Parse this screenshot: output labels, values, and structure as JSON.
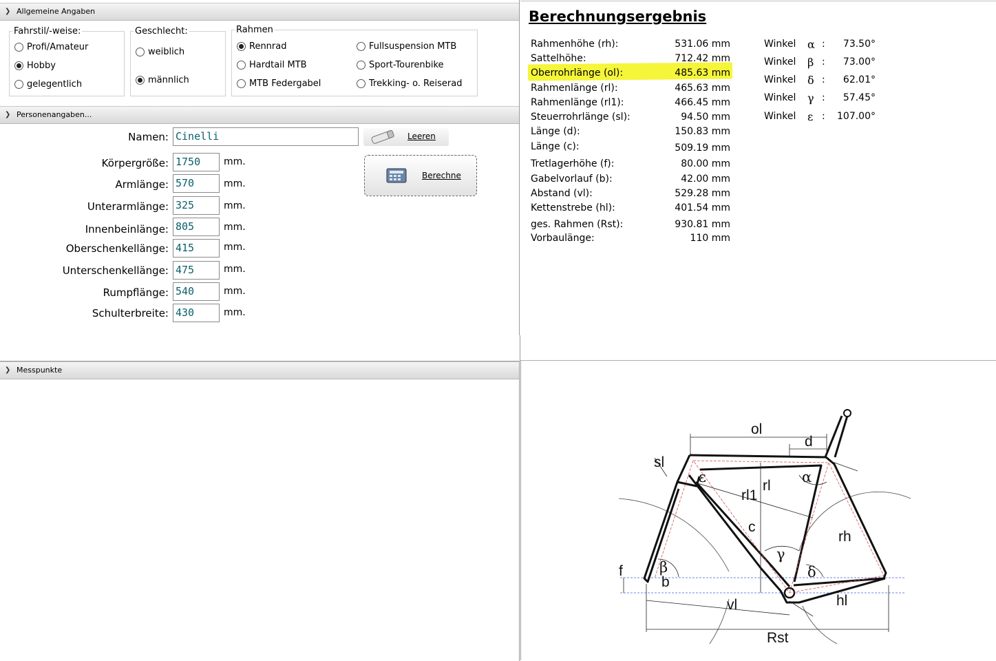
{
  "sections": {
    "general": "Allgemeine Angaben",
    "person": "Personenangaben...",
    "measure": "Messpunkte"
  },
  "ridingStyle": {
    "legend": "Fahrstil/-weise:",
    "options": [
      "Profi/Amateur",
      "Hobby",
      "gelegentlich"
    ],
    "selected": "Hobby"
  },
  "gender": {
    "legend": "Geschlecht:",
    "options": [
      "weiblich",
      "männlich"
    ],
    "selected": "männlich"
  },
  "frame": {
    "legend": "Rahmen",
    "options": [
      "Rennrad",
      "Fullsuspension MTB",
      "Hardtail MTB",
      "Sport-Tourenbike",
      "MTB Federgabel",
      "Trekking- o. Reiserad"
    ],
    "selected": "Rennrad"
  },
  "person": {
    "name_label": "Namen:",
    "name_value": "Cinelli",
    "unit": "mm.",
    "fields": [
      {
        "label": "Körpergröße:",
        "value": "1750"
      },
      {
        "label": "Armlänge:",
        "value": "570"
      },
      {
        "label": "Unterarmlänge:",
        "value": "325"
      },
      {
        "label": "Innenbeinlänge:",
        "value": "805"
      },
      {
        "label": "Oberschenkellänge:",
        "value": "415"
      },
      {
        "label": "Unterschenkellänge:",
        "value": "475"
      },
      {
        "label": "Rumpflänge:",
        "value": "540"
      },
      {
        "label": "Schulterbreite:",
        "value": "430"
      }
    ]
  },
  "buttons": {
    "clear": "Leeren",
    "calc": "Berechne"
  },
  "results": {
    "title": "Berechnungsergebnis",
    "rows": [
      {
        "label": "Rahmenhöhe (rh):",
        "value": "531.06 mm"
      },
      {
        "label": "Sattelhöhe:",
        "value": "712.42 mm"
      },
      {
        "label": "Oberrohrlänge (ol):",
        "value": "485.63 mm"
      },
      {
        "label": "Rahmenlänge (rl):",
        "value": "465.63 mm"
      },
      {
        "label": "Rahmenlänge (rl1):",
        "value": "466.45 mm"
      },
      {
        "label": "Steuerrohrlänge (sl):",
        "value": "94.50 mm"
      },
      {
        "label": "Länge (d):",
        "value": "150.83 mm"
      },
      {
        "label": "Länge (c):",
        "value": "509.19 mm"
      },
      {
        "label": "Tretlagerhöhe (f):",
        "value": "80.00 mm"
      },
      {
        "label": "Gabelvorlauf (b):",
        "value": "42.00 mm"
      },
      {
        "label": "Abstand (vl):",
        "value": "529.28 mm"
      },
      {
        "label": "Kettenstrebe (hl):",
        "value": "401.54 mm"
      },
      {
        "label": "ges. Rahmen (Rst):",
        "value": "930.81 mm"
      },
      {
        "label": "Vorbaulänge:",
        "value": "110 mm"
      }
    ],
    "highlight_color": "#f5f53a",
    "angles": [
      {
        "word": "Winkel",
        "sym": "α",
        "value": "73.50°"
      },
      {
        "word": "Winkel",
        "sym": "β",
        "value": "73.00°"
      },
      {
        "word": "Winkel",
        "sym": "δ",
        "value": "62.01°"
      },
      {
        "word": "Winkel",
        "sym": "γ",
        "value": "57.45°"
      },
      {
        "word": "Winkel",
        "sym": "ε",
        "value": "107.00°"
      }
    ]
  },
  "diagram": {
    "labels": {
      "ol": "ol",
      "d": "d",
      "sl": "sl",
      "eps": "ε",
      "alpha": "α",
      "rl": "rl",
      "rl1": "rl1",
      "c": "c",
      "gamma": "γ",
      "rh": "rh",
      "f": "f",
      "beta": "β",
      "b": "b",
      "delta": "δ",
      "vl": "vl",
      "hl": "hl",
      "rst": "Rst"
    }
  }
}
